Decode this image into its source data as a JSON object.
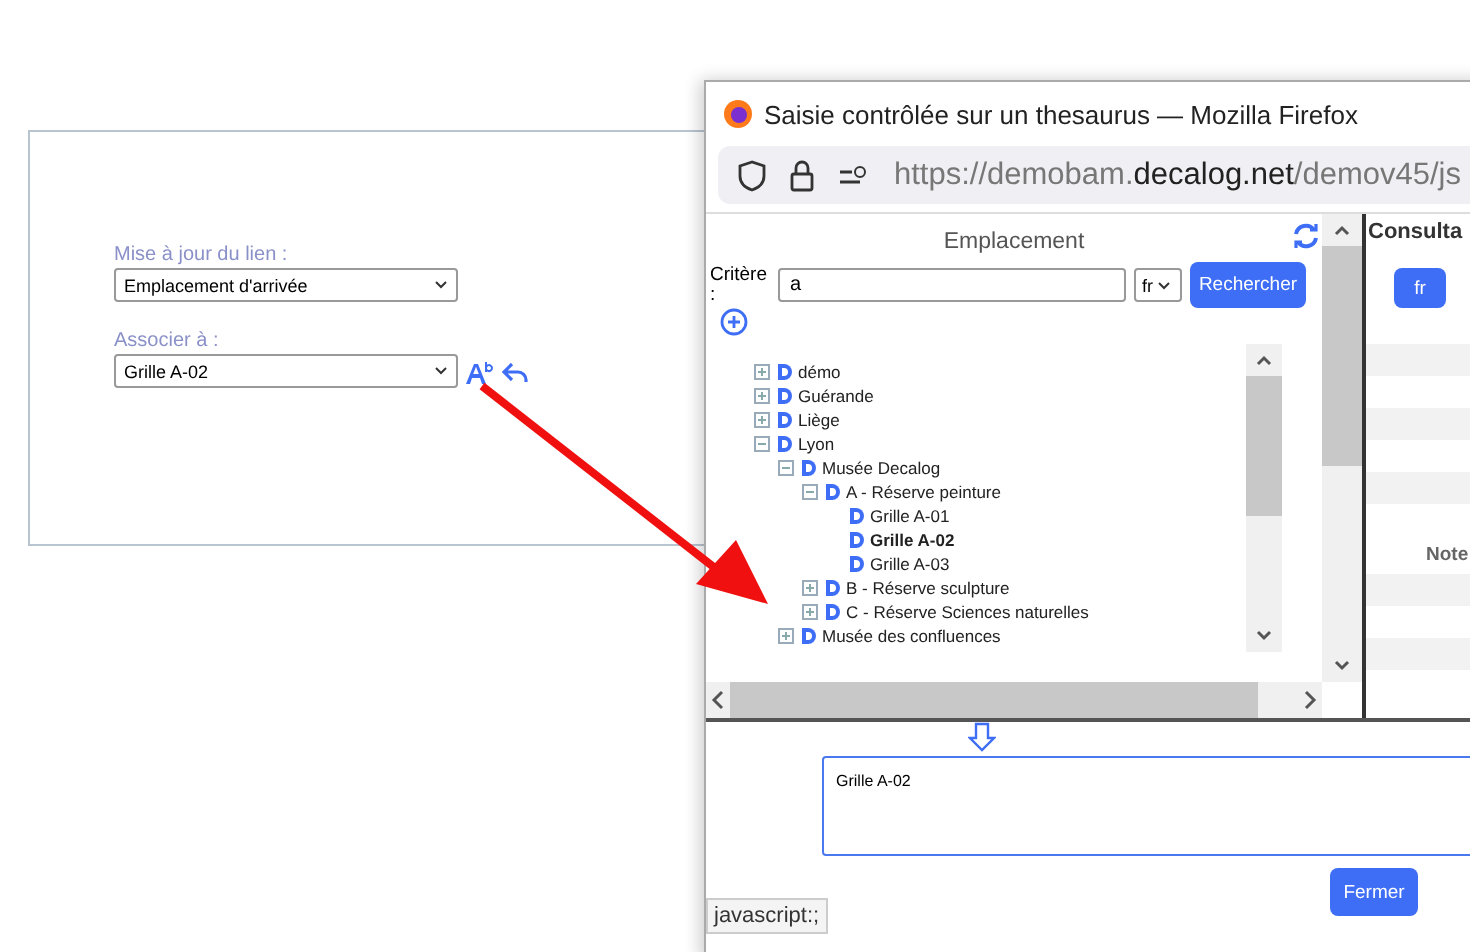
{
  "form": {
    "fields": [
      {
        "label": "Mise à jour du lien :",
        "value": "Emplacement d'arrivée"
      },
      {
        "label": "Associer à :",
        "value": "Grille A-02"
      }
    ]
  },
  "popup": {
    "title": "Saisie contrôlée sur un thesaurus — Mozilla Firefox",
    "url_start": "https://demobam.",
    "url_domain": "decalog.net",
    "url_end": "/demov45/js",
    "left_panel": {
      "heading": "Emplacement",
      "criteria_label": "Critère :",
      "search_value": "a",
      "language": "fr",
      "search_button": "Rechercher",
      "tree": [
        {
          "label": "démo",
          "expanded": false,
          "selected": false
        },
        {
          "label": "Guérande",
          "expanded": false,
          "selected": false
        },
        {
          "label": "Liège",
          "expanded": false,
          "selected": false
        },
        {
          "label": "Lyon",
          "expanded": true,
          "selected": false,
          "children": [
            {
              "label": "Musée Decalog",
              "expanded": true,
              "selected": false,
              "children": [
                {
                  "label": "A - Réserve peinture",
                  "expanded": true,
                  "selected": false,
                  "children": [
                    {
                      "label": "Grille A-01",
                      "selected": false
                    },
                    {
                      "label": "Grille A-02",
                      "selected": true
                    },
                    {
                      "label": "Grille A-03",
                      "selected": false
                    }
                  ]
                },
                {
                  "label": "B - Réserve sculpture",
                  "expanded": false,
                  "selected": false
                },
                {
                  "label": "C - Réserve Sciences naturelles",
                  "expanded": false,
                  "selected": false
                }
              ]
            },
            {
              "label": "Musée des confluences",
              "expanded": false,
              "selected": false
            }
          ]
        }
      ]
    },
    "right_panel": {
      "heading": "Consulta",
      "language_button": "fr",
      "column_label": "Note"
    },
    "result_value": "Grille A-02",
    "close_button": "Fermer",
    "status_link": "javascript:;"
  }
}
